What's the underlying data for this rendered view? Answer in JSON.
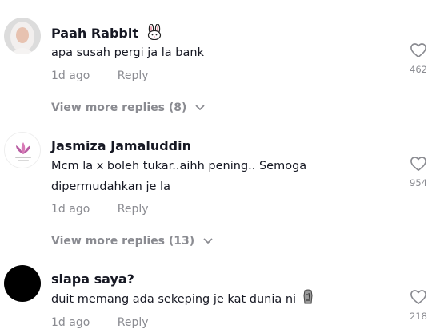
{
  "comments": [
    {
      "username": "Paah Rabbit",
      "username_emoji": "rabbit-face-emoji",
      "text": "apa susah pergi ja la bank",
      "time": "1d ago",
      "reply_label": "Reply",
      "likes": "462",
      "view_more": "View more replies (8)"
    },
    {
      "username": "Jasmiza Jamaluddin",
      "text": "Mcm la x boleh tukar..aihh pening.. Semoga dipermudahkan je la",
      "time": "1d ago",
      "reply_label": "Reply",
      "likes": "954",
      "view_more": "View more replies (13)"
    },
    {
      "username": "siapa saya?",
      "text": "duit memang ada sekeping je kat dunia ni",
      "text_emoji": "moai-emoji",
      "time": "1d ago",
      "reply_label": "Reply",
      "likes": "218"
    }
  ],
  "icons": {
    "like": "heart-outline-icon",
    "expand": "chevron-down-icon"
  },
  "colors": {
    "primary_text": "#161823",
    "secondary_text": "#8a8b91",
    "avatar_dark": "#000000"
  }
}
